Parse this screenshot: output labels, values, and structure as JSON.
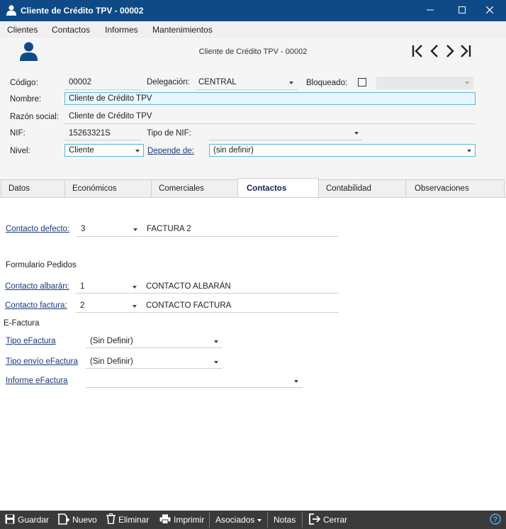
{
  "window": {
    "title": "Cliente de Crédito TPV - 00002",
    "icon": "user-icon",
    "controls": [
      "minimize-icon",
      "maximize-icon",
      "close-icon"
    ]
  },
  "menu": [
    "Clientes",
    "Contactos",
    "Informes",
    "Mantenimientos"
  ],
  "header": {
    "record_title": "Cliente de Crédito TPV - 00002",
    "nav_icons": [
      "first-record-icon",
      "previous-record-icon",
      "next-record-icon",
      "last-record-icon"
    ]
  },
  "form": {
    "codigo_label": "Código:",
    "codigo_value": "00002",
    "delegacion_label": "Delegación:",
    "delegacion_value": "CENTRAL",
    "bloqueado_label": "Bloqueado:",
    "bloqueado_checked": false,
    "nombre_label": "Nombre:",
    "nombre_value": "Cliente de Crédito TPV",
    "razon_label": "Razón social:",
    "razon_value": "Cliente de Crédito TPV",
    "nif_label": "NIF:",
    "nif_value": "15263321S",
    "tipo_nif_label": "Tipo de NIF:",
    "tipo_nif_value": "",
    "nivel_label": "Nivel:",
    "nivel_value": "Cliente",
    "depende_label": "Depende de:",
    "depende_value": "(sin definir)"
  },
  "tabs": [
    {
      "label": "Datos",
      "active": false
    },
    {
      "label": "Económicos",
      "active": false
    },
    {
      "label": "Comerciales",
      "active": false
    },
    {
      "label": "Contactos",
      "active": true
    },
    {
      "label": "Contabilidad",
      "active": false
    },
    {
      "label": "Observaciones",
      "active": false
    }
  ],
  "contactos": {
    "defecto_label": "Contacto defecto:",
    "defecto_num": "3",
    "defecto_name": "FACTURA 2",
    "formulario_label": "Formulario Pedidos",
    "albaran_label": "Contacto albarán:",
    "albaran_num": "1",
    "albaran_name": "CONTACTO ALBARÁN",
    "factura_label": "Contacto factura:",
    "factura_num": "2",
    "factura_name": "CONTACTO FACTURA",
    "efactura_label": "E-Factura",
    "tipo_efactura_label": "Tipo eFactura",
    "tipo_efactura_value": "(Sin Definir)",
    "tipo_envio_label": "Tipo envío eFactura",
    "tipo_envio_value": "(Sin Definir)",
    "informe_label": "Informe eFactura",
    "informe_value": ""
  },
  "toolbar": {
    "guardar": "Guardar",
    "nuevo": "Nuevo",
    "eliminar": "Eliminar",
    "imprimir": "Imprimir",
    "asociados": "Asociados",
    "notas": "Notas",
    "cerrar": "Cerrar",
    "help_icon": "help-icon"
  },
  "colors": {
    "titlebar": "#0f4a86",
    "toolbar": "#3a3a3a",
    "focus_border": "#5ab7d6",
    "link": "#1a3a7a",
    "help": "#4aa8e0"
  }
}
